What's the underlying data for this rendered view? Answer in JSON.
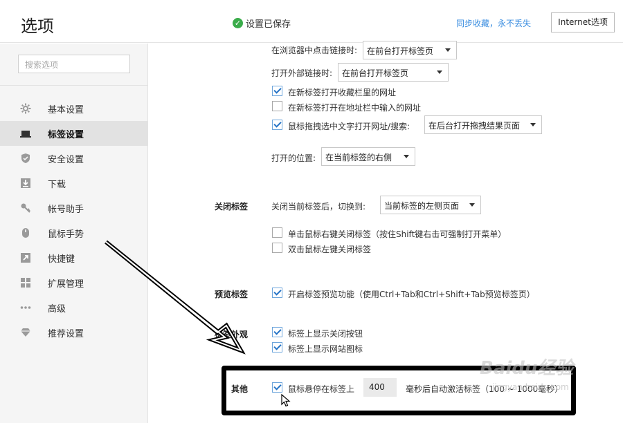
{
  "header": {
    "title": "选项",
    "saved_status": "设置已保存",
    "sync_link": "同步收藏，永不丢失",
    "internet_options_btn": "Internet选项"
  },
  "sidebar": {
    "search_placeholder": "搜索选项",
    "items": [
      {
        "label": "基本设置",
        "icon": "gear-icon"
      },
      {
        "label": "标签设置",
        "icon": "tab-icon"
      },
      {
        "label": "安全设置",
        "icon": "shield-icon"
      },
      {
        "label": "下载",
        "icon": "download-icon"
      },
      {
        "label": "帐号助手",
        "icon": "key-icon"
      },
      {
        "label": "鼠标手势",
        "icon": "mouse-icon"
      },
      {
        "label": "快捷键",
        "icon": "shortcut-icon"
      },
      {
        "label": "扩展管理",
        "icon": "extensions-icon"
      },
      {
        "label": "高级",
        "icon": "more-icon"
      },
      {
        "label": "推荐设置",
        "icon": "diamond-icon"
      }
    ],
    "active_index": 1
  },
  "main": {
    "middle_click_label": "在浏览器中点击链接时:",
    "middle_click_value": "在前台打开标签页",
    "external_link_label": "打开外部链接时:",
    "external_link_value": "在前台打开标签页",
    "cb_fav_new_tab": "在新标签打开收藏栏里的网址",
    "cb_address_new_tab": "在新标签打开在地址栏中输入的网址",
    "cb_drag_text": "鼠标拖拽选中文字打开网址/搜索:",
    "drag_result_value": "在后台打开拖拽结果页面",
    "open_position_label": "打开的位置:",
    "open_position_value": "在当前标签的右侧",
    "close_tab_section": "关闭标签",
    "close_tab_label": "关闭当前标签后，切换到:",
    "close_tab_value": "当前标签的左侧页面",
    "cb_right_click_close": "单击鼠标右键关闭标签（按住Shift键右击可强制打开菜单）",
    "cb_double_click_close": "双击鼠标左键关闭标签",
    "preview_section": "预览标签",
    "cb_preview": "开启标签预览功能（使用Ctrl+Tab和Ctrl+Shift+Tab预览标签页）",
    "appearance_section": "标签外观",
    "cb_show_close": "标签上显示关闭按钮",
    "cb_show_favicon": "标签上显示网站图标",
    "other_section": "其他",
    "cb_hover_activate": "鼠标悬停在标签上",
    "hover_ms": "400",
    "hover_suffix": "毫秒后自动激活标签（100 ~ 1000毫秒）"
  },
  "watermark": {
    "brand": "Baidu经验",
    "url": "jingyan.baidu.com"
  },
  "colors": {
    "accent": "#3b8ee0",
    "ok_green": "#3aac4a",
    "check_blue": "#2674c6",
    "sidebar_bg": "#f5f5f5"
  }
}
